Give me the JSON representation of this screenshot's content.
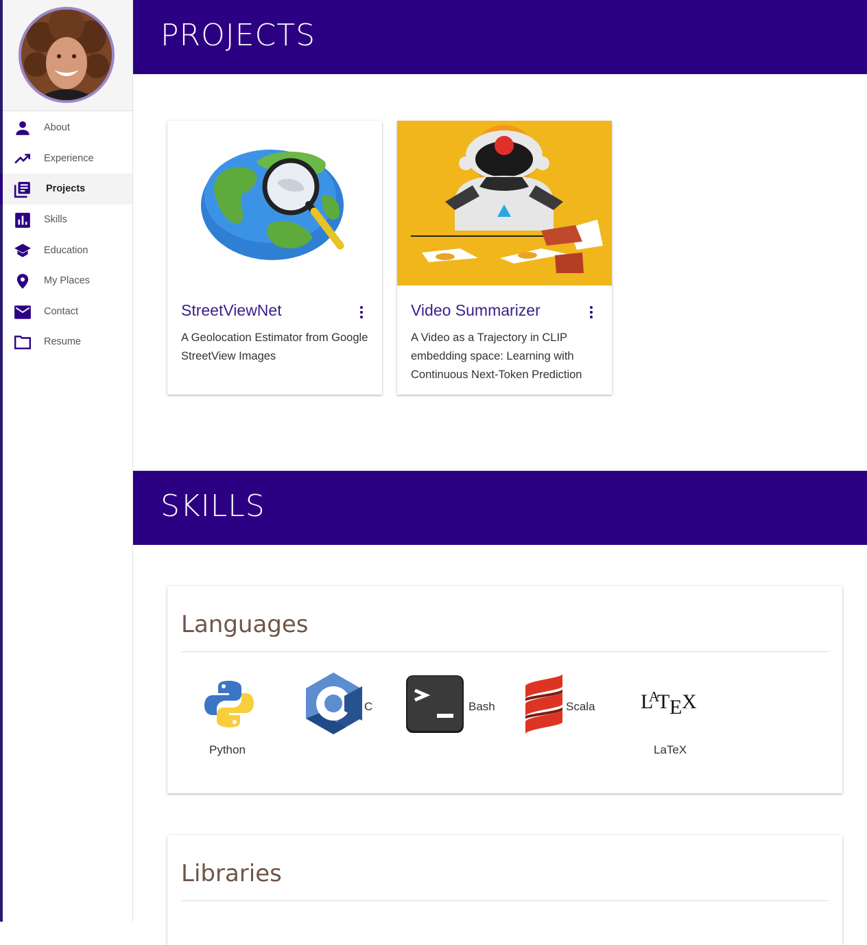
{
  "sidebar": {
    "items": [
      {
        "label": "About",
        "icon": "person-icon"
      },
      {
        "label": "Experience",
        "icon": "trending-up-icon"
      },
      {
        "label": "Projects",
        "icon": "library-books-icon",
        "active": true
      },
      {
        "label": "Skills",
        "icon": "bar-chart-icon"
      },
      {
        "label": "Education",
        "icon": "school-icon"
      },
      {
        "label": "My Places",
        "icon": "location-pin-icon"
      },
      {
        "label": "Contact",
        "icon": "mail-icon"
      },
      {
        "label": "Resume",
        "icon": "folder-icon"
      }
    ]
  },
  "projects": {
    "heading": "PROJECTS",
    "cards": [
      {
        "title": "StreetViewNet",
        "description": "A Geolocation Estimator from Google StreetView Images",
        "image": "globe-magnifier-illustration"
      },
      {
        "title": "Video Summarizer",
        "description": "A Video as a Trajectory in CLIP embedding space: Learning with Continuous Next-Token Prediction",
        "image": "robot-cards-illustration"
      }
    ]
  },
  "skills": {
    "heading": "SKILLS",
    "languages": {
      "title": "Languages",
      "items": [
        {
          "label": "Python",
          "icon": "python-logo-icon"
        },
        {
          "label": "C",
          "icon": "c-logo-icon"
        },
        {
          "label": "Bash",
          "icon": "terminal-icon"
        },
        {
          "label": "Scala",
          "icon": "scala-logo-icon"
        },
        {
          "label": "LaTeX",
          "icon": "latex-logo-icon",
          "logo_text": "LATEX"
        }
      ]
    },
    "libraries": {
      "title": "Libraries"
    }
  },
  "colors": {
    "band": "#2c0083",
    "accent": "#3a1f8a",
    "skill_heading": "#6f5548"
  }
}
